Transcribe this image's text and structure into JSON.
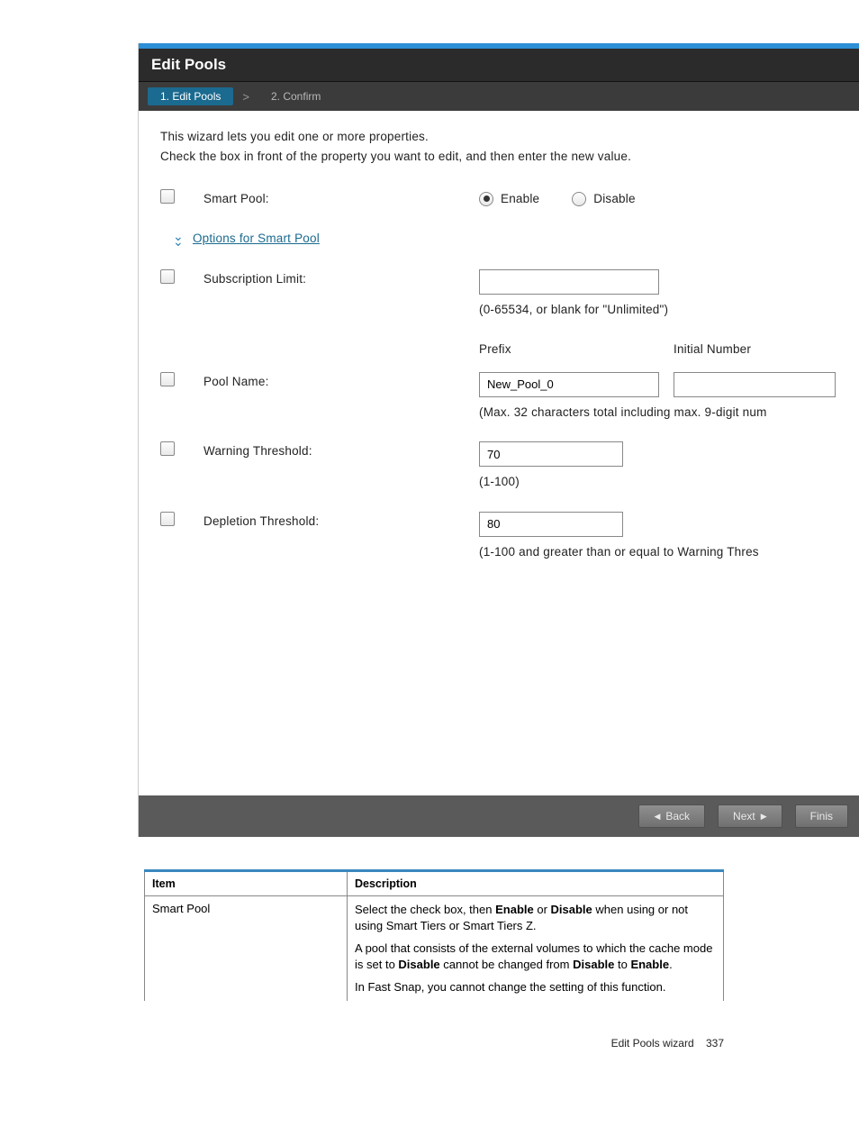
{
  "wizard": {
    "title": "Edit Pools",
    "steps": [
      {
        "index": "1.",
        "label": "Edit Pools",
        "active": true
      },
      {
        "index": "2.",
        "label": "Confirm",
        "active": false
      }
    ],
    "intro_line1": "This wizard lets you edit one or more properties.",
    "intro_line2": "Check the  box in front of the property you want to edit, and then enter the new value.",
    "smart_pool": {
      "label": "Smart Pool:",
      "enable_label": "Enable",
      "disable_label": "Disable",
      "selected": "enable",
      "options_link": "Options for Smart Pool"
    },
    "subscription_limit": {
      "label": "Subscription Limit:",
      "value": "",
      "hint": "(0-65534, or blank for \"Unlimited\")"
    },
    "pool_name": {
      "label": "Pool Name:",
      "prefix_header": "Prefix",
      "initial_header": "Initial Number",
      "prefix_value": "New_Pool_0",
      "initial_value": "",
      "hint": "(Max. 32 characters total including max. 9-digit num"
    },
    "warning_threshold": {
      "label": "Warning Threshold:",
      "value": "70",
      "hint": "(1-100)"
    },
    "depletion_threshold": {
      "label": "Depletion Threshold:",
      "value": "80",
      "hint": "(1-100 and greater than or equal to Warning Thres"
    },
    "buttons": {
      "back": "Back",
      "next": "Next",
      "finish": "Finis"
    }
  },
  "desc_table": {
    "headers": {
      "item": "Item",
      "description": "Description"
    },
    "rows": [
      {
        "item": "Smart Pool",
        "desc_html": "Select the check box, then <b>Enable</b> or <b>Disable</b> when using or not using Smart Tiers or Smart Tiers Z.|A pool that consists of the external volumes to which the cache mode is set to <b>Disable</b> cannot be changed from <b>Disable</b> to <b>Enable</b>.|In Fast Snap, you cannot change the setting of this function."
      }
    ]
  },
  "footer": {
    "text": "Edit Pools wizard",
    "page": "337"
  }
}
